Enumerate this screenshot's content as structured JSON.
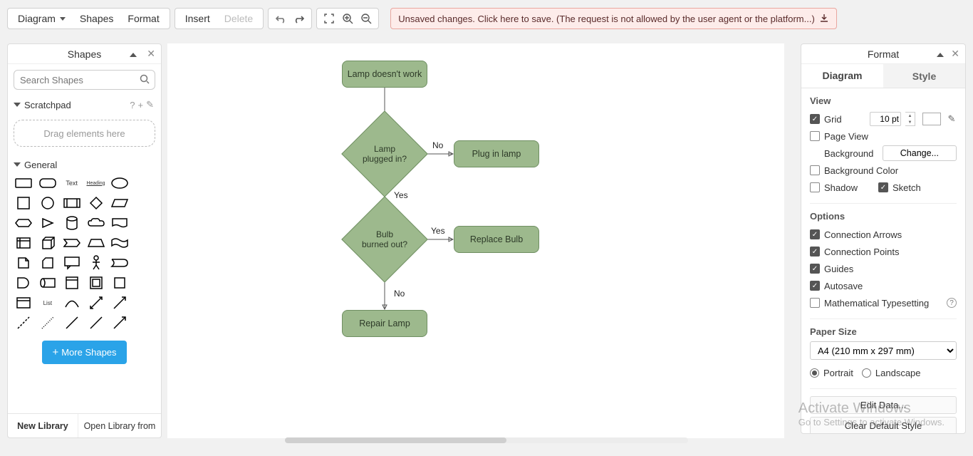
{
  "menubar": {
    "diagram": "Diagram",
    "shapes": "Shapes",
    "format": "Format",
    "insert": "Insert",
    "delete": "Delete"
  },
  "save_banner": "Unsaved changes. Click here to save. (The request is not allowed by the user agent or the platform...)",
  "left": {
    "title": "Shapes",
    "search_placeholder": "Search Shapes",
    "scratchpad": "Scratchpad",
    "drop_hint": "Drag elements here",
    "general": "General",
    "more": "More Shapes",
    "new_lib": "New Library",
    "open_lib": "Open Library from"
  },
  "flow": {
    "n1": "Lamp doesn't work",
    "d1": "Lamp\nplugged in?",
    "n2": "Plug in lamp",
    "d2": "Bulb\nburned out?",
    "n3": "Replace Bulb",
    "n4": "Repair Lamp",
    "yes": "Yes",
    "no": "No"
  },
  "right": {
    "title": "Format",
    "tab_diagram": "Diagram",
    "tab_style": "Style",
    "view": "View",
    "grid": "Grid",
    "grid_val": "10 pt",
    "pageview": "Page View",
    "background": "Background",
    "change": "Change...",
    "bgcolor": "Background Color",
    "shadow": "Shadow",
    "sketch": "Sketch",
    "options": "Options",
    "conn_arrows": "Connection Arrows",
    "conn_points": "Connection Points",
    "guides": "Guides",
    "autosave": "Autosave",
    "math": "Mathematical Typesetting",
    "paper": "Paper Size",
    "paper_val": "A4 (210 mm x 297 mm)",
    "portrait": "Portrait",
    "landscape": "Landscape",
    "edit_data": "Edit Data...",
    "clear_style": "Clear Default Style"
  },
  "watermark": {
    "l1": "Activate Windows",
    "l2": "Go to Settings to activate Windows."
  }
}
